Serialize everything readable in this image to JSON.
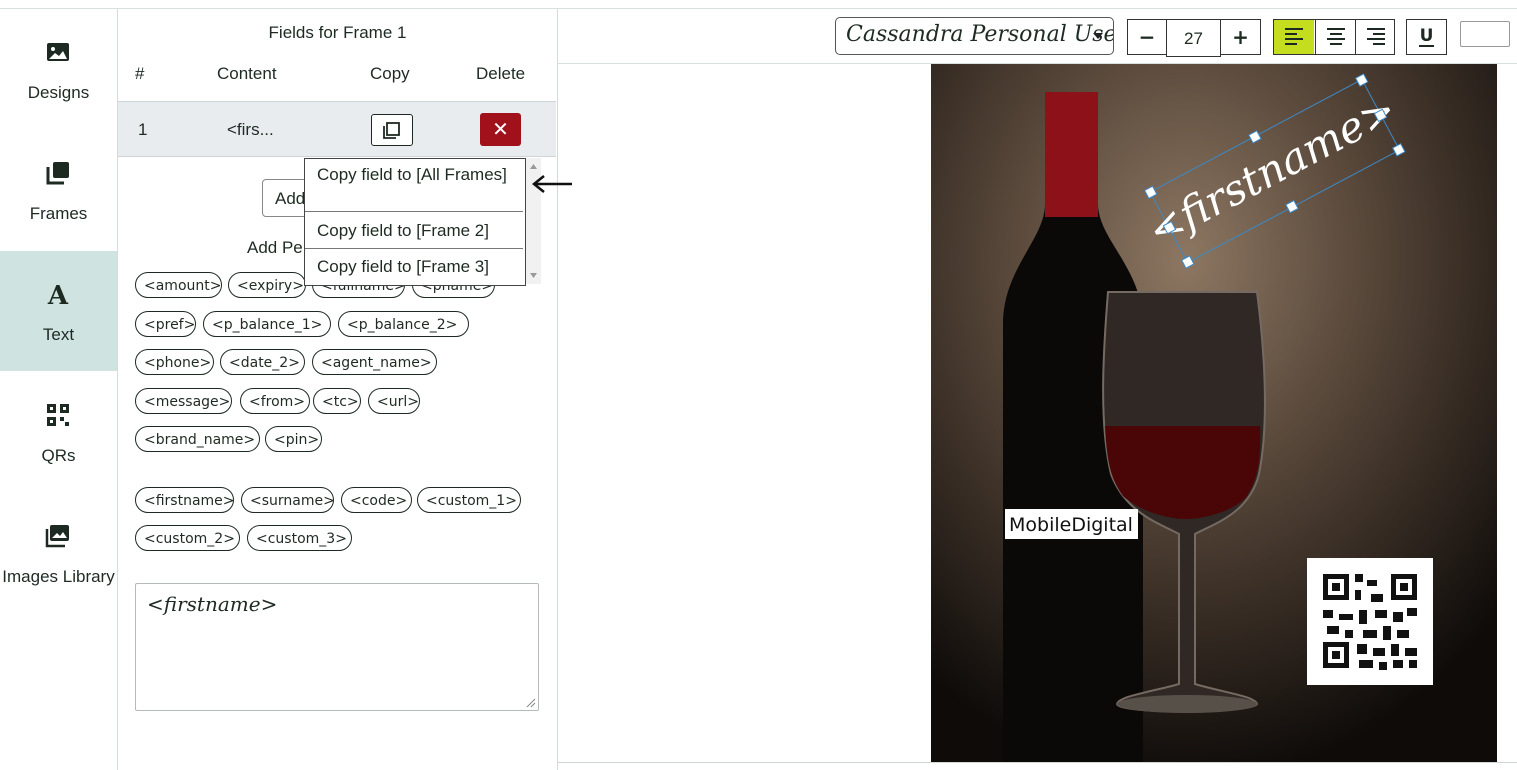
{
  "sidebar": {
    "items": [
      {
        "label": "Designs",
        "icon": "image-icon"
      },
      {
        "label": "Frames",
        "icon": "frames-icon"
      },
      {
        "label": "Text",
        "icon": "text-icon",
        "active": true
      },
      {
        "label": "QRs",
        "icon": "qr-icon"
      },
      {
        "label": "Images Library",
        "icon": "images-library-icon"
      }
    ]
  },
  "fields": {
    "title": "Fields for Frame 1",
    "headers": {
      "num": "#",
      "content": "Content",
      "copy": "Copy",
      "delete": "Delete"
    },
    "rows": [
      {
        "num": "1",
        "content": "<firs..."
      }
    ],
    "add_label": "Add",
    "add_personalization": "Add Pe",
    "tags_group1": [
      "<amount>",
      "<expiry>",
      "<fullname>",
      "<phame>",
      "<pref>",
      "<p_balance_1>",
      "<p_balance_2>",
      "<phone>",
      "<date_2>",
      "<agent_name>",
      "<message>",
      "<from>",
      "<tc>",
      "<url>",
      "<brand_name>",
      "<pin>"
    ],
    "tags_group2": [
      "<firstname>",
      "<surname>",
      "<code>",
      "<custom_1>",
      "<custom_2>",
      "<custom_3>"
    ],
    "editor_text": "<firstname>"
  },
  "copy_menu": {
    "items": [
      "Copy field to [All Frames]",
      "Copy field to [Frame 2]",
      "Copy field to [Frame 3]"
    ]
  },
  "toolbar": {
    "font": "Cassandra Personal Use",
    "minus": "−",
    "size": "27",
    "plus": "+",
    "underline": "U",
    "accent_color": "#c4dd1e"
  },
  "canvas": {
    "field_text": "<firstname>",
    "logo_text": "MobileDigital"
  },
  "colors": {
    "active_rail": "#cfe3e0",
    "delete": "#a0111c"
  }
}
